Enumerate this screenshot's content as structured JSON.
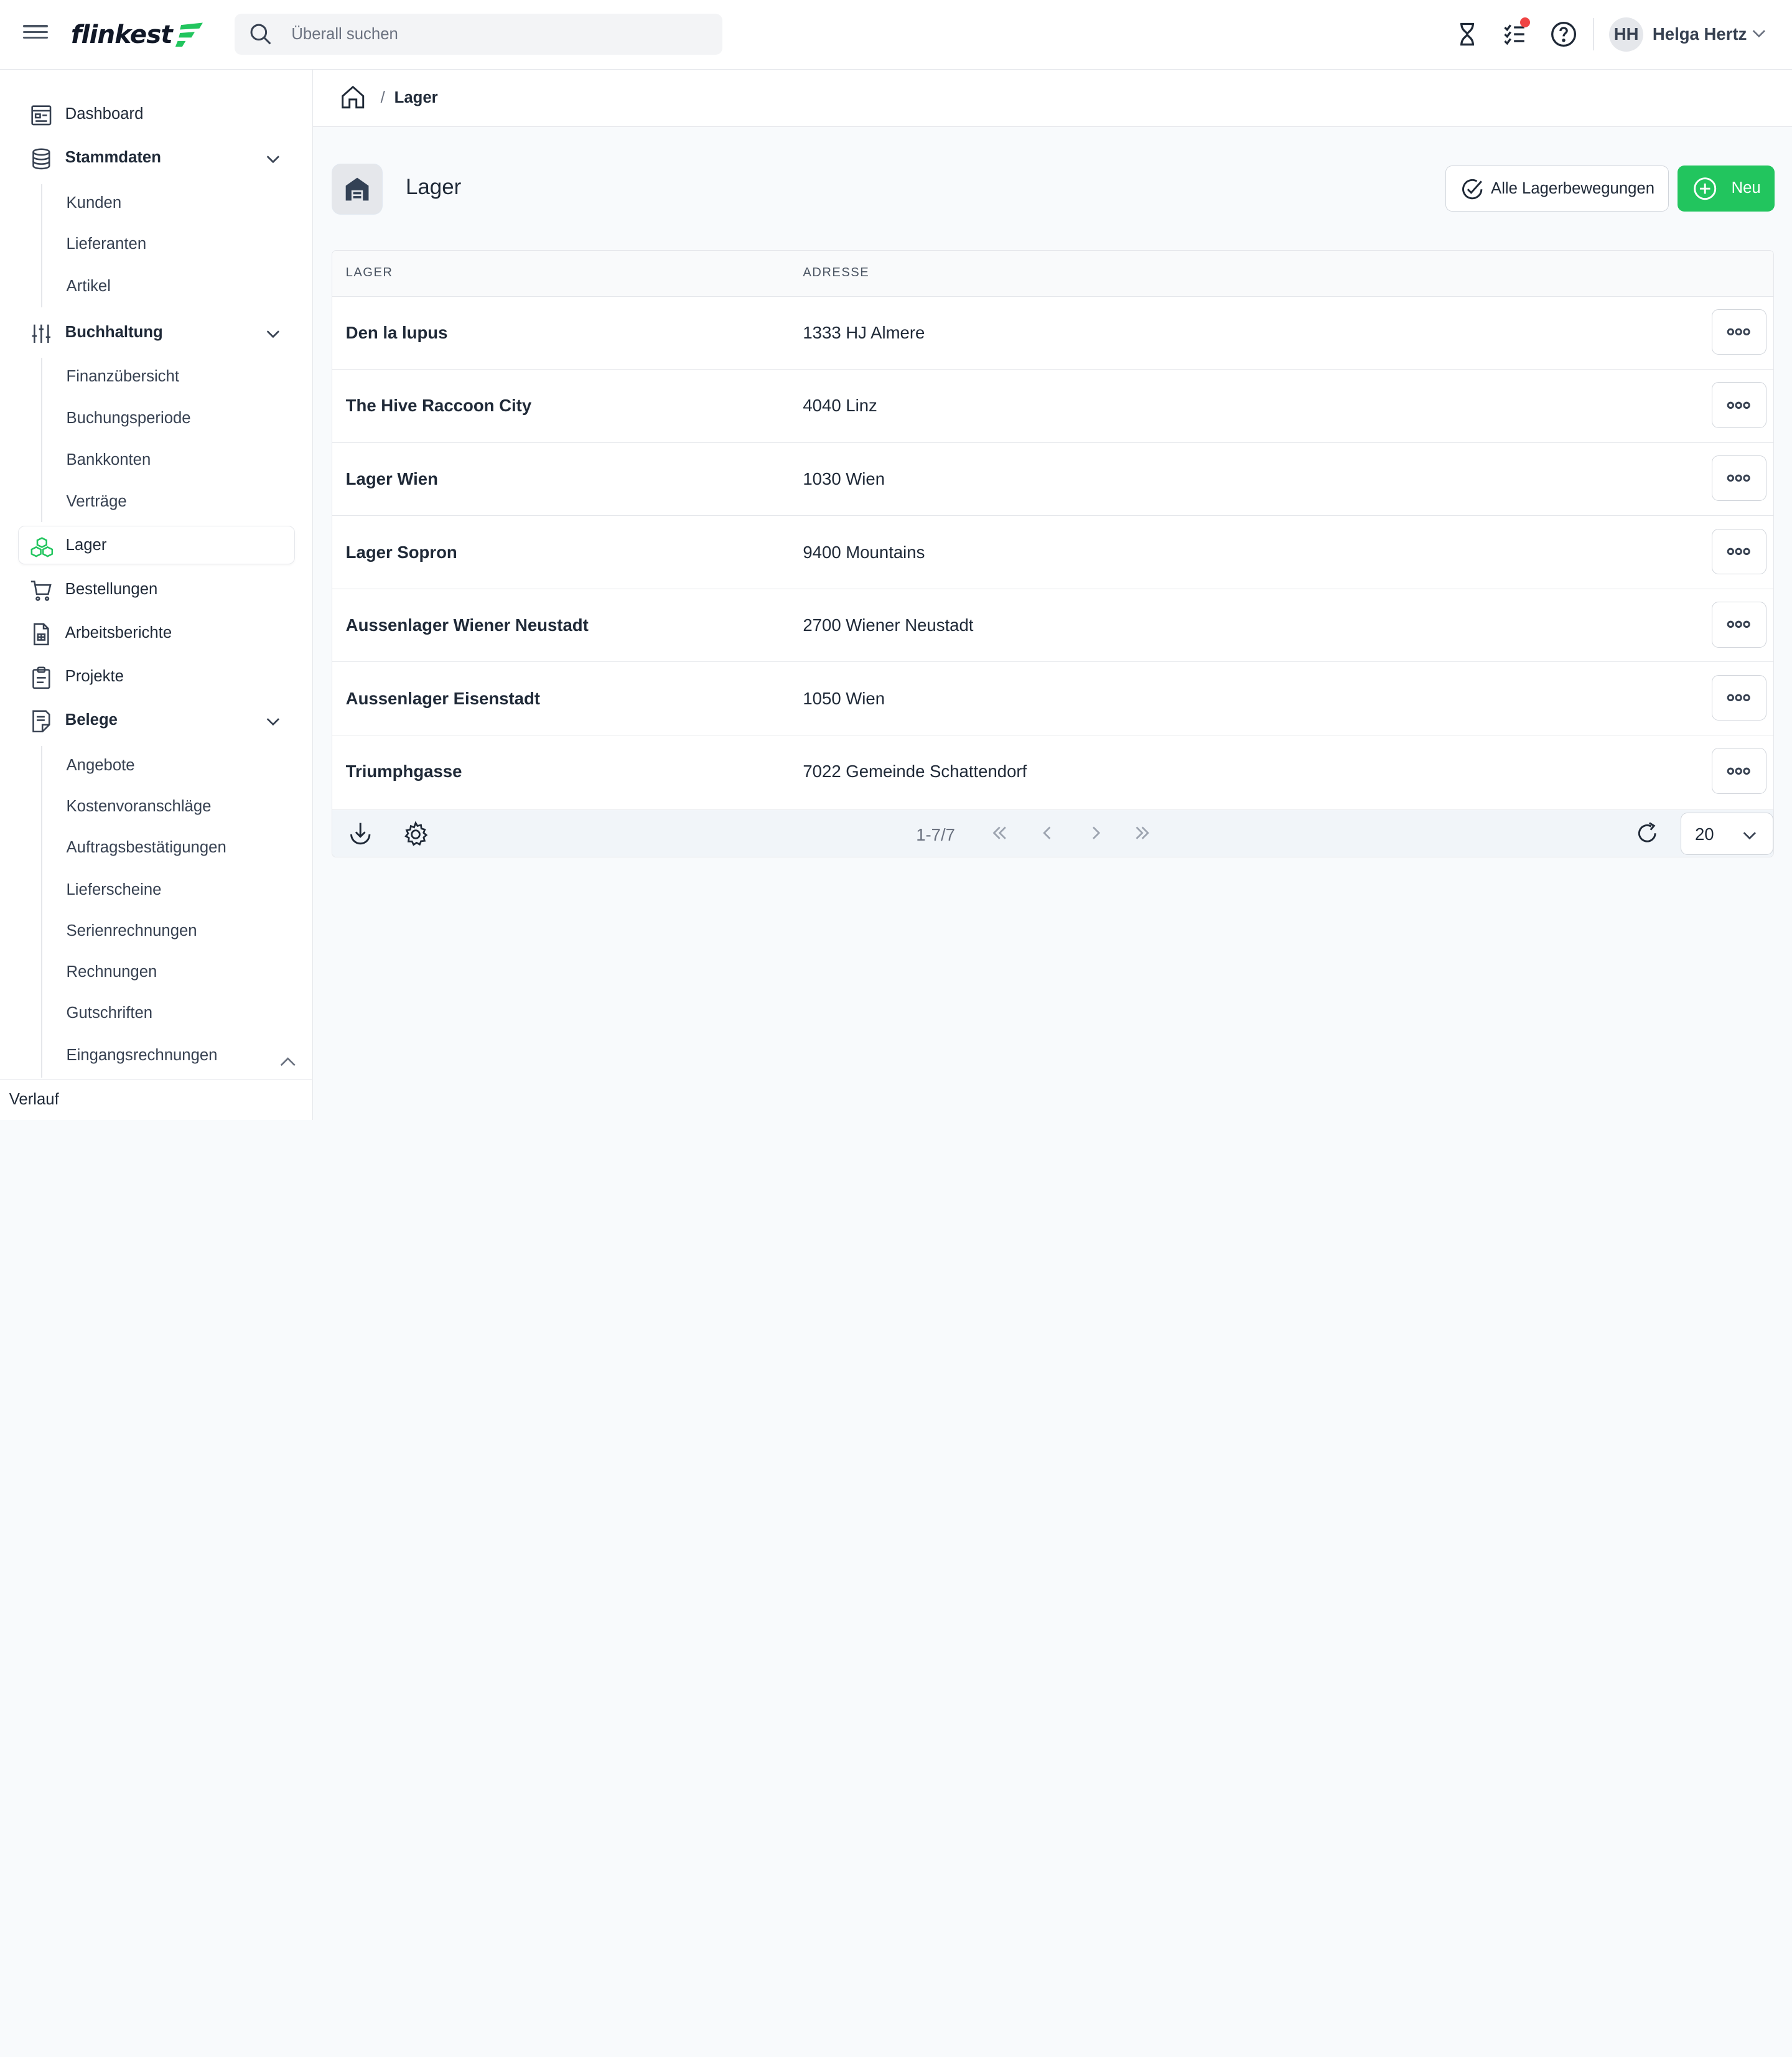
{
  "app": {
    "logo_text": "flinkest",
    "brand_color": "#22c55e"
  },
  "topbar": {
    "search_placeholder": "Überall suchen",
    "user_initials": "HH",
    "user_name": "Helga Hertz",
    "icons": [
      "hourglass-icon",
      "tasks-icon",
      "help-icon"
    ],
    "notification_color": "#ef4444"
  },
  "sidebar": {
    "items": [
      {
        "label": "Dashboard",
        "icon": "dashboard-icon"
      },
      {
        "label": "Stammdaten",
        "icon": "database-icon",
        "expanded": true,
        "children": [
          "Kunden",
          "Lieferanten",
          "Artikel"
        ]
      },
      {
        "label": "Buchhaltung",
        "icon": "sliders-icon",
        "expanded": true,
        "children": [
          "Finanzübersicht",
          "Buchungsperiode",
          "Bankkonten",
          "Verträge"
        ]
      },
      {
        "label": "Lager",
        "icon": "boxes-icon",
        "active": true
      },
      {
        "label": "Bestellungen",
        "icon": "cart-icon"
      },
      {
        "label": "Arbeitsberichte",
        "icon": "report-icon"
      },
      {
        "label": "Projekte",
        "icon": "clipboard-icon"
      },
      {
        "label": "Belege",
        "icon": "receipt-icon",
        "expanded": true,
        "children": [
          "Angebote",
          "Kostenvoranschläge",
          "Auftragsbestätigungen",
          "Lieferscheine",
          "Serienrechnungen",
          "Rechnungen",
          "Gutschriften",
          "Eingangsrechnungen"
        ]
      }
    ],
    "footer_label": "Verlauf"
  },
  "breadcrumb": {
    "separator": "/",
    "current": "Lager"
  },
  "page": {
    "title": "Lager",
    "btn_all_movements": "Alle Lagerbewegungen",
    "btn_new": "Neu"
  },
  "table": {
    "columns": [
      "LAGER",
      "ADRESSE"
    ],
    "rows": [
      {
        "name": "Den la lupus",
        "address": "1333 HJ Almere"
      },
      {
        "name": "The Hive Raccoon City",
        "address": "4040 Linz"
      },
      {
        "name": "Lager Wien",
        "address": "1030 Wien"
      },
      {
        "name": "Lager Sopron",
        "address": "9400 Mountains"
      },
      {
        "name": "Aussenlager Wiener Neustadt",
        "address": "2700 Wiener Neustadt"
      },
      {
        "name": "Aussenlager Eisenstadt",
        "address": "1050 Wien"
      },
      {
        "name": "Triumphgasse",
        "address": "7022 Gemeinde Schattendorf"
      }
    ],
    "pagination": {
      "info": "1-7/7",
      "page_size": "20"
    }
  }
}
